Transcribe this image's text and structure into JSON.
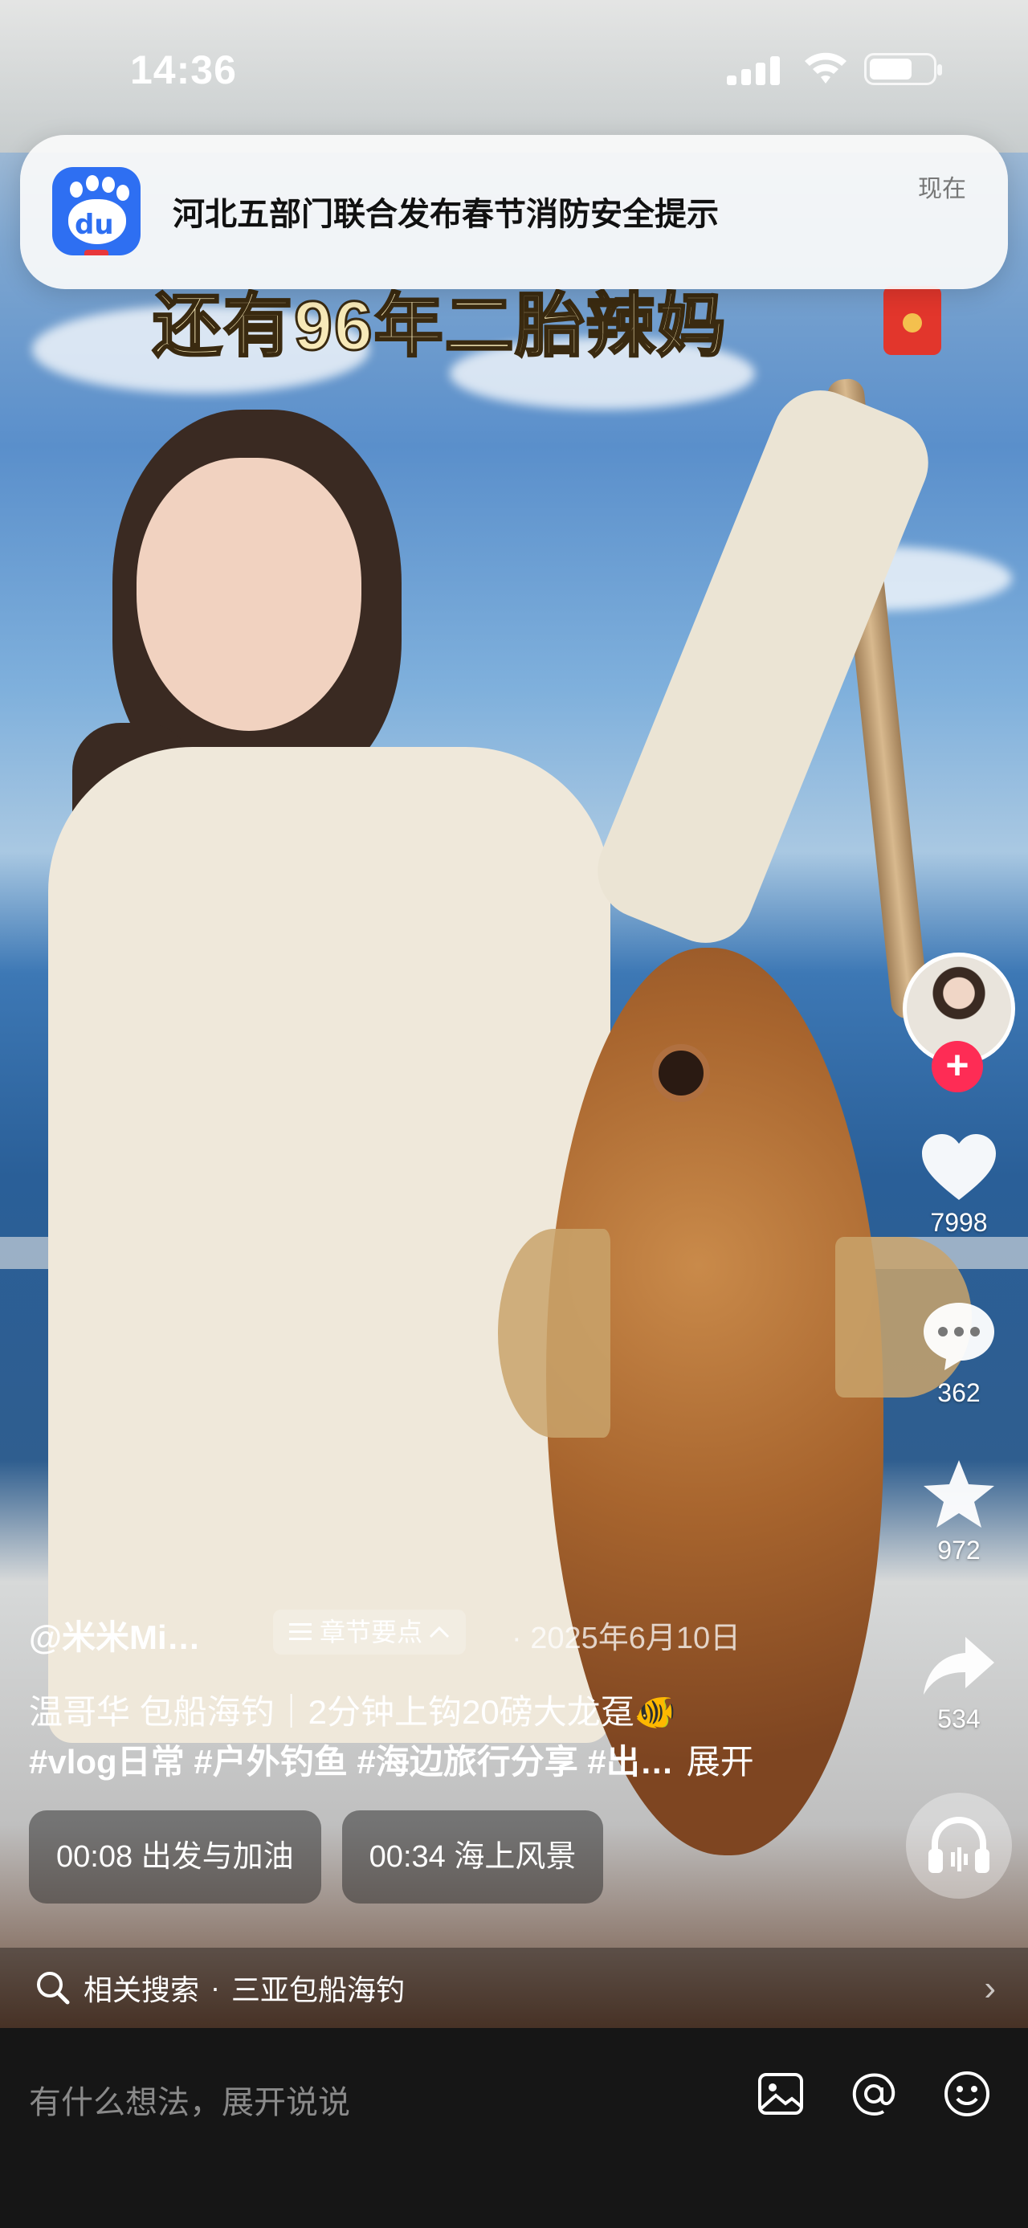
{
  "status_bar": {
    "time": "14:36"
  },
  "notification": {
    "app_icon": "baidu-app-icon",
    "icon_text": "du",
    "message": "河北五部门联合发布春节消防安全提示",
    "time": "现在"
  },
  "video": {
    "overlay_title": "还有96年二胎辣妈"
  },
  "side_actions": {
    "follow_label": "+",
    "likes": "7998",
    "comments": "362",
    "favorites": "972",
    "shares": "534"
  },
  "caption": {
    "author": "@米米Mi…",
    "chapter_chip": "章节要点",
    "date": "· 2025年6月10日",
    "description": "温哥华 包船海钓｜2分钟上钩20磅大龙趸🐠",
    "tags": "#vlog日常 #户外钓鱼 #海边旅行分享 #出…",
    "expand": "展开"
  },
  "chapters": [
    {
      "time": "00:08",
      "title": "出发与加油"
    },
    {
      "time": "00:34",
      "title": "海上风景"
    }
  ],
  "related_search": {
    "label": "相关搜索",
    "separator": "·",
    "query": "三亚包船海钓"
  },
  "comment_bar": {
    "placeholder": "有什么想法，展开说说"
  },
  "colors": {
    "accent_red": "#fe2c55",
    "notification_bg": "#fafafa",
    "comment_bar_bg": "#161616"
  }
}
